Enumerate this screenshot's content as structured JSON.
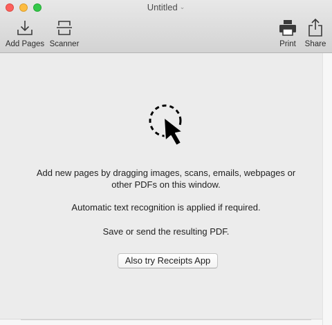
{
  "window": {
    "title": "Untitled"
  },
  "toolbar": {
    "add_pages": {
      "label": "Add Pages",
      "icon": "download-tray-icon"
    },
    "scanner": {
      "label": "Scanner",
      "icon": "scanner-icon"
    },
    "print": {
      "label": "Print",
      "icon": "printer-icon"
    },
    "share": {
      "label": "Share",
      "icon": "share-icon"
    }
  },
  "main": {
    "illustration_icon": "drag-cursor-icon",
    "instructions": {
      "line1": "Add new pages by dragging images, scans, emails, webpages or",
      "line2": "other PDFs on this window.",
      "line3": "Automatic text recognition is applied if required.",
      "line4": "Save or send the resulting PDF."
    },
    "receipts_button_label": "Also try Receipts App"
  },
  "colors": {
    "close": "#fc605c",
    "minimize": "#fdbc40",
    "maximize": "#34c84a",
    "background": "#ececec"
  }
}
